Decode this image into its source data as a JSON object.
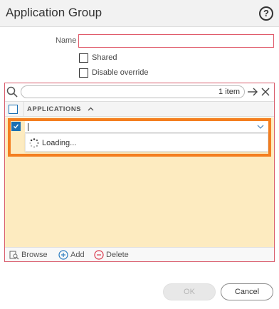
{
  "dialog": {
    "title": "Application Group",
    "help_icon_glyph": "?"
  },
  "form": {
    "name_label": "Name",
    "name_value": "",
    "shared_label": "Shared",
    "shared_checked": false,
    "disable_override_label": "Disable override",
    "disable_override_checked": false
  },
  "grid": {
    "search_value": "",
    "item_count": "1 item",
    "column_header": "APPLICATIONS",
    "sort_direction": "ascending",
    "rows": [
      {
        "checked": true,
        "value": "",
        "dropdown_status": "Loading..."
      }
    ]
  },
  "footer": {
    "browse_label": "Browse",
    "add_label": "Add",
    "delete_label": "Delete"
  },
  "buttons": {
    "ok_label": "OK",
    "ok_enabled": false,
    "cancel_label": "Cancel"
  },
  "colors": {
    "accent": "#1a6fb3",
    "highlight_border": "#f47e1f",
    "row_background": "#fdebc0",
    "error_border": "#d95c6c"
  },
  "icons": [
    "help-icon",
    "search-icon",
    "arrow-right-icon",
    "close-icon",
    "sort-up-icon",
    "chevron-down-icon",
    "spinner-icon",
    "browse-icon",
    "add-icon",
    "delete-icon"
  ]
}
